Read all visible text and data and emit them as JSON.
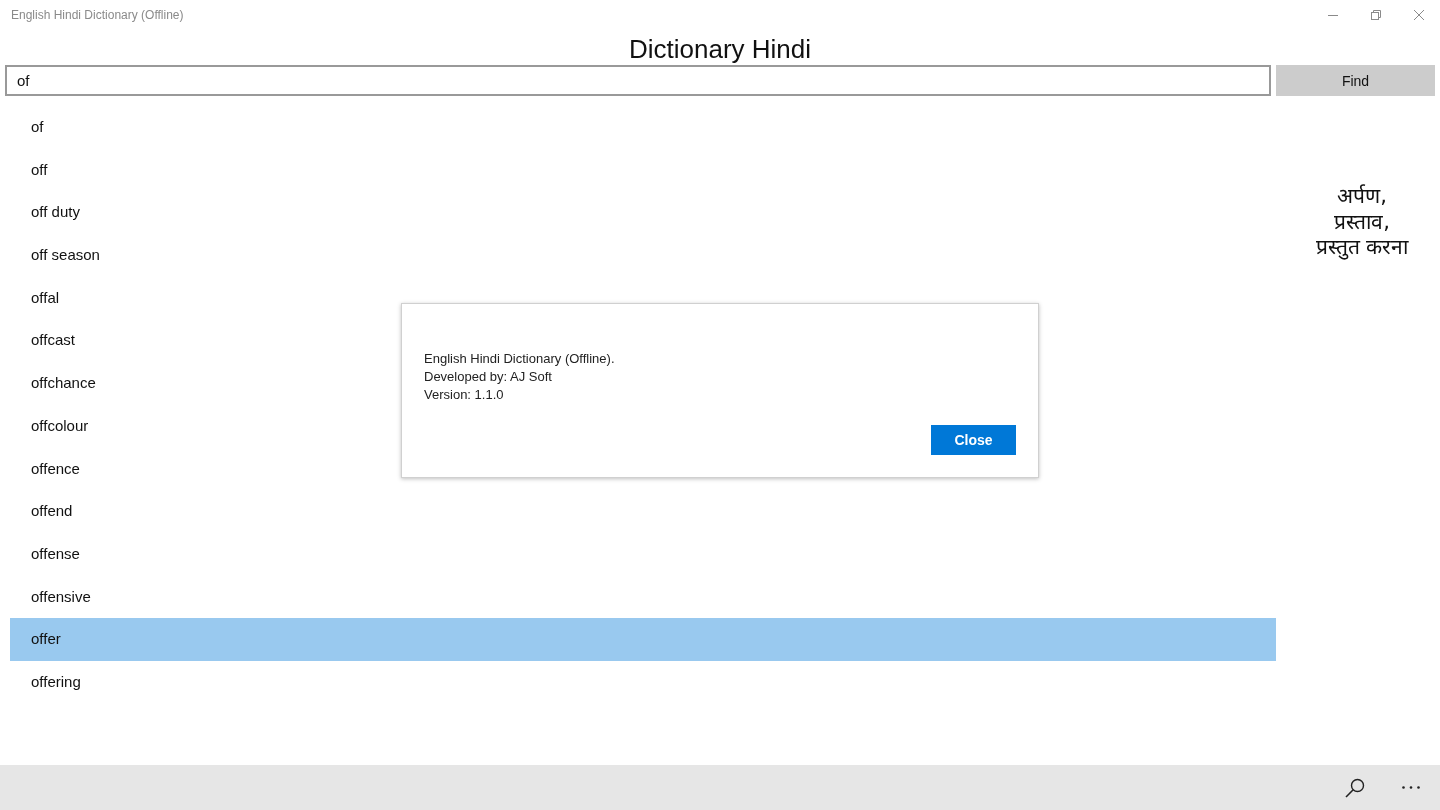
{
  "window": {
    "title": "English Hindi Dictionary (Offline)"
  },
  "header": {
    "title": "Dictionary Hindi"
  },
  "search": {
    "value": "of",
    "button": "Find"
  },
  "results": [
    {
      "word": "of",
      "selected": false
    },
    {
      "word": "off",
      "selected": false
    },
    {
      "word": "off duty",
      "selected": false
    },
    {
      "word": "off season",
      "selected": false
    },
    {
      "word": "offal",
      "selected": false
    },
    {
      "word": "offcast",
      "selected": false
    },
    {
      "word": "offchance",
      "selected": false
    },
    {
      "word": "offcolour",
      "selected": false
    },
    {
      "word": "offence",
      "selected": false
    },
    {
      "word": "offend",
      "selected": false
    },
    {
      "word": "offense",
      "selected": false
    },
    {
      "word": "offensive",
      "selected": false
    },
    {
      "word": "offer",
      "selected": true
    },
    {
      "word": "offering",
      "selected": false
    }
  ],
  "meaning": "अर्पण, प्रस्ताव, प्रस्तुत करना",
  "dialog": {
    "lines": [
      "English Hindi Dictionary (Offline).",
      "Developed by: AJ Soft",
      "Version: 1.1.0"
    ],
    "button": "Close"
  }
}
